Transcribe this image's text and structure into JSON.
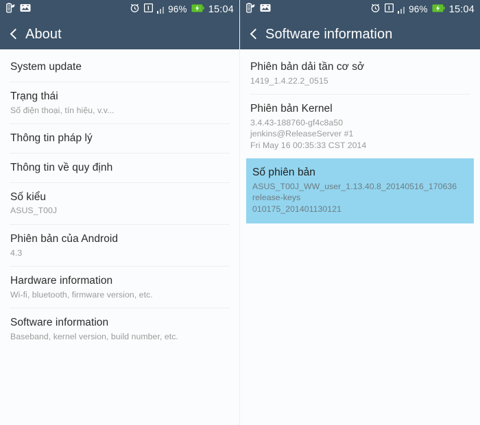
{
  "status_bar": {
    "icons_left": [
      "power-saver-leaf-icon",
      "screenshot-image-icon"
    ],
    "icons_right": [
      "alarm-clock-icon",
      "sim-1-icon",
      "signal-bars-icon",
      "charging-battery-icon"
    ],
    "sim_label": "1",
    "battery_percent": "96%",
    "clock": "15:04",
    "background_color": "#3c5369",
    "battery_color": "#5ec02a"
  },
  "left_screen": {
    "title": "About",
    "back_icon": "back-chevron-icon",
    "items": [
      {
        "title": "System update",
        "sub": []
      },
      {
        "title": "Trạng thái",
        "sub": [
          "Số điện thoại, tín hiệu, v.v..."
        ]
      },
      {
        "title": "Thông tin pháp lý",
        "sub": []
      },
      {
        "title": "Thông tin về quy định",
        "sub": []
      },
      {
        "title": "Số kiểu",
        "sub": [
          "ASUS_T00J"
        ]
      },
      {
        "title": "Phiên bản của Android",
        "sub": [
          "4.3"
        ]
      },
      {
        "title": "Hardware information",
        "sub": [
          "Wi-fi, bluetooth, firmware version, etc."
        ]
      },
      {
        "title": "Software information",
        "sub": [
          "Baseband, kernel version, build number, etc."
        ]
      }
    ]
  },
  "right_screen": {
    "title": "Software information",
    "back_icon": "back-chevron-icon",
    "highlight_color": "#93d5ef",
    "items": [
      {
        "title": "Phiên bản dải tần cơ sở",
        "sub": [
          "1419_1.4.22.2_0515"
        ],
        "selected": false
      },
      {
        "title": "Phiên bản Kernel",
        "sub": [
          "3.4.43-188760-gf4c8a50",
          "jenkins@ReleaseServer #1",
          "Fri May 16 00:35:33 CST 2014"
        ],
        "selected": false
      },
      {
        "title": "Số phiên bản",
        "sub": [
          "ASUS_T00J_WW_user_1.13.40.8_20140516_170636 release-keys",
          "010175_201401130121"
        ],
        "selected": true
      }
    ]
  }
}
